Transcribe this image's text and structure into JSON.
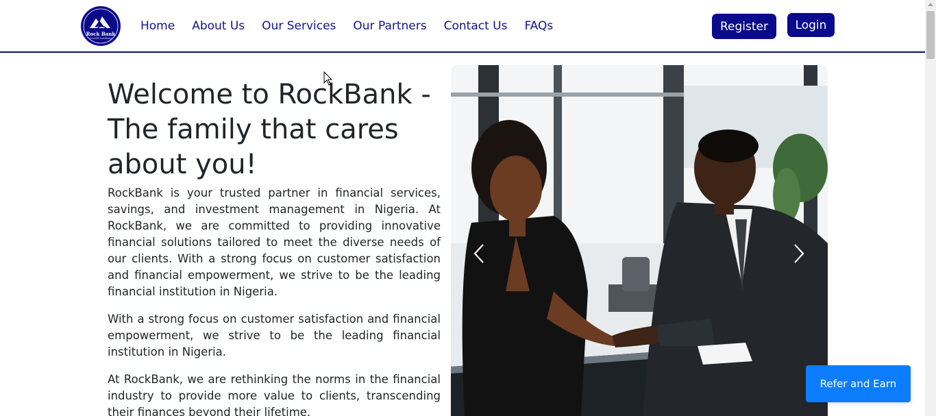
{
  "brand": {
    "logo_text": "Rock Bank",
    "logo_subtext": "wealth building"
  },
  "nav": {
    "links": [
      "Home",
      "About Us",
      "Our Services",
      "Our Partners",
      "Contact Us",
      "FAQs"
    ],
    "register_label": "Register",
    "login_label": "Login"
  },
  "hero": {
    "title": "Welcome to RockBank - The family that cares about you!",
    "paragraphs": [
      "RockBank is your trusted partner in financial services, savings, and investment management in Nigeria. At RockBank, we are committed to providing innovative financial solutions tailored to meet the diverse needs of our clients. With a strong focus on customer satisfaction and financial empowerment, we strive to be the leading financial institution in Nigeria.",
      "With a strong focus on customer satisfaction and financial empowerment, we strive to be the leading financial institution in Nigeria.",
      "At RockBank, we are rethinking the norms in the financial industry to provide more value to clients, transcending their finances beyond their lifetime."
    ]
  },
  "carousel": {
    "prev_icon": "chevron-left-icon",
    "next_icon": "chevron-right-icon"
  },
  "floating": {
    "refer_label": "Refer and Earn"
  },
  "colors": {
    "brand_navy": "#0a0a8c",
    "nav_text": "#14148c",
    "refer_blue": "#0d7dfd"
  }
}
